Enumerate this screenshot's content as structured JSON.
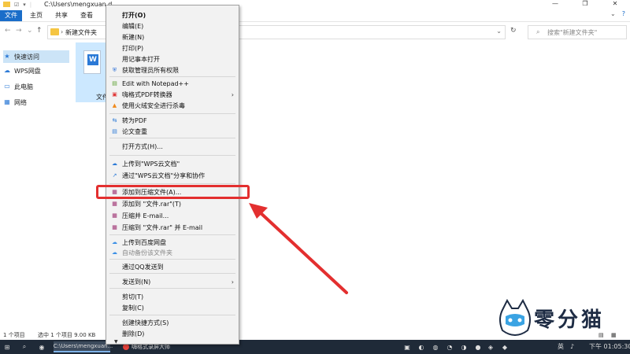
{
  "window": {
    "title": "C:\\Users\\mengxuan.d",
    "controls": [
      "—",
      "❐",
      "✕"
    ]
  },
  "ribbon": {
    "tabs": [
      "文件",
      "主页",
      "共享",
      "查看"
    ],
    "active_tab": "文件"
  },
  "address": {
    "path": "新建文件夹",
    "search_placeholder": "搜索\"新建文件夹\""
  },
  "sidebar": {
    "items": [
      "快速访问",
      "WPS网盘",
      "此电脑",
      "网络"
    ]
  },
  "file": {
    "label": "文件",
    "icon_letter": "W"
  },
  "status": {
    "count": "1 个项目",
    "selection": "选中 1 个项目  9.00 KB"
  },
  "context_menu": {
    "items": [
      {
        "label": "打开(O)",
        "bold": true
      },
      {
        "label": "编辑(E)"
      },
      {
        "label": "新建(N)"
      },
      {
        "label": "打印(P)"
      },
      {
        "label": "用记事本打开"
      },
      {
        "label": "获取管理员所有权限",
        "icon": "shield-icon"
      },
      {
        "label": "Edit with Notepad++",
        "icon": "notepad-icon"
      },
      {
        "label": "嗨格式PDF转换器",
        "icon": "pdf-icon",
        "submenu": true
      },
      {
        "label": "使用火绒安全进行杀毒",
        "icon": "huorong-icon"
      },
      {
        "label": "转为PDF",
        "icon": "convert-icon"
      },
      {
        "label": "论文查重",
        "icon": "doc-check-icon"
      },
      {
        "label": "打开方式(H)..."
      },
      {
        "label": "上传到\"WPS云文档\"",
        "icon": "cloud-upload-icon"
      },
      {
        "label": "通过\"WPS云文档\"分享和协作",
        "icon": "share-icon"
      },
      {
        "label": "添加到压缩文件(A)...",
        "icon": "winrar-icon"
      },
      {
        "label": "添加到 \"文件.rar\"(T)",
        "icon": "winrar-icon"
      },
      {
        "label": "压缩并 E-mail...",
        "icon": "winrar-icon"
      },
      {
        "label": "压缩到 \"文件.rar\" 并 E-mail",
        "icon": "winrar-icon"
      },
      {
        "label": "上传到百度网盘",
        "icon": "baidu-icon"
      },
      {
        "label": "自动备份该文件夹",
        "icon": "baidu-icon",
        "disabled": true
      },
      {
        "label": "通过QQ发送到"
      },
      {
        "label": "发送到(N)",
        "submenu": true
      },
      {
        "label": "剪切(T)"
      },
      {
        "label": "复制(C)"
      },
      {
        "label": "创建快捷方式(S)"
      },
      {
        "label": "删除(D)"
      }
    ]
  },
  "taskbar": {
    "explorer_label": "C:\\Users\\mengxuan...",
    "app2_label": "嗨格式录屏大师",
    "ime": "英",
    "clock": "下午 01:05:30"
  },
  "watermark": {
    "text": "零分猫"
  },
  "colors": {
    "accent": "#1a6dc9",
    "highlight": "#e32f2f",
    "taskbar": "#1f2a38"
  }
}
